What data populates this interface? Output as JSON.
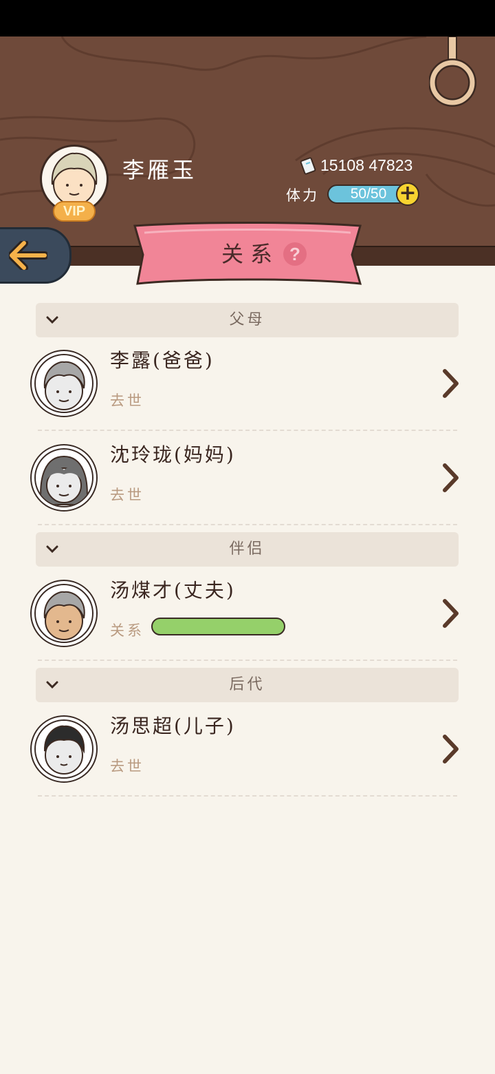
{
  "player": {
    "name": "李雁玉",
    "vip_label": "VIP",
    "money": "15108 47823",
    "stamina_label": "体力",
    "stamina": "50/50",
    "stamina_add": "+"
  },
  "ribbon": {
    "title": "关系",
    "help": "?"
  },
  "sections": [
    {
      "title": "父母"
    },
    {
      "title": "伴侣"
    },
    {
      "title": "后代"
    }
  ],
  "relations": [
    {
      "name": "李露(爸爸)",
      "status": "去世"
    },
    {
      "name": "沈玲珑(妈妈)",
      "status": "去世"
    },
    {
      "name": "汤煤才(丈夫)",
      "status": "关系",
      "bar_level": 1.0
    },
    {
      "name": "汤思超(儿子)",
      "status": "去世"
    }
  ],
  "colors": {
    "header_wood": "#6f4a3a",
    "ribbon_pink": "#f18597",
    "relation_bar": "#95d06a",
    "stamina_bar": "#6cc3dc",
    "background": "#f8f4ec"
  }
}
